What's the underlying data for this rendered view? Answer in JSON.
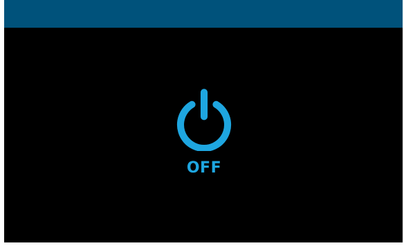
{
  "header": {
    "color": "#00527b"
  },
  "power": {
    "state_label": "OFF",
    "icon": "power-icon",
    "accent_color": "#1ea6e0"
  },
  "background_color": "#000000"
}
